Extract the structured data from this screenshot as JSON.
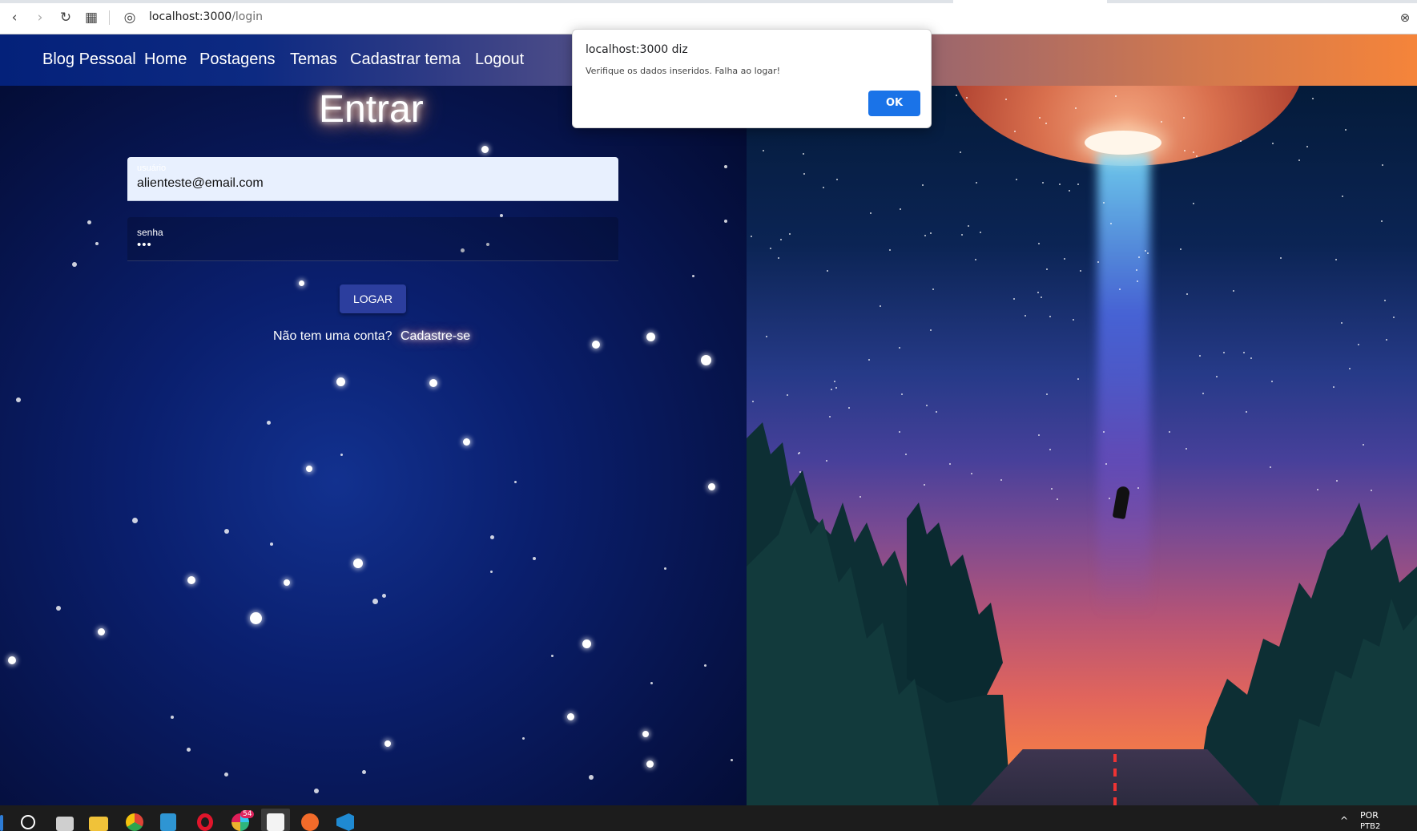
{
  "browser": {
    "url_host": "localhost:3000",
    "url_path": "/login",
    "back_icon": "‹",
    "forward_icon": "›",
    "reload_icon": "↻",
    "apps_icon": "▦",
    "site_icon": "◎",
    "close_icon": "⊗"
  },
  "navbar": {
    "brand": "Blog Pessoal",
    "items": [
      "Home",
      "Postagens",
      "Temas",
      "Cadastrar tema",
      "Logout"
    ]
  },
  "login": {
    "title": "Entrar",
    "user_label": "usuário",
    "user_value": "alienteste@email.com",
    "password_label": "senha",
    "password_value": "•••",
    "submit_label": "LOGAR",
    "signup_prompt": "Não tem uma conta?",
    "signup_link": "Cadastre-se"
  },
  "alert": {
    "title": "localhost:3000 diz",
    "message": "Verifique os dados inseridos. Falha ao logar!",
    "ok_label": "OK"
  },
  "taskbar": {
    "badge_count": "54",
    "language": "POR",
    "layout": "PTB2",
    "tray_up_icon": "^"
  },
  "colors": {
    "accent_button": "#2c3e9e",
    "alert_ok": "#1a73e8"
  }
}
